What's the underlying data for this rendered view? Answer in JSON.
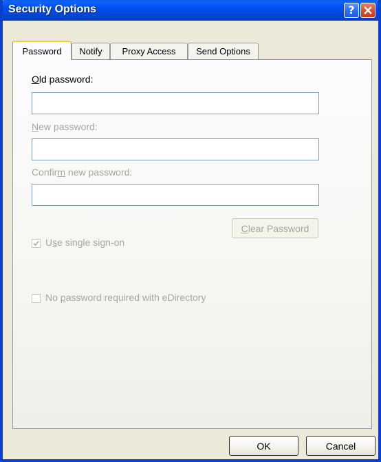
{
  "window": {
    "title": "Security Options",
    "help_glyph": "?",
    "close_glyph": "×"
  },
  "tabs": [
    {
      "label": "Password",
      "active": true
    },
    {
      "label": "Notify",
      "active": false
    },
    {
      "label": "Proxy Access",
      "active": false
    },
    {
      "label": "Send Options",
      "active": false
    }
  ],
  "password_tab": {
    "old_password": {
      "label_prefix": "",
      "label_mnemonic": "O",
      "label_suffix": "ld password:",
      "value": ""
    },
    "new_password": {
      "label_prefix": "",
      "label_mnemonic": "N",
      "label_suffix": "ew password:",
      "value": ""
    },
    "confirm_password": {
      "label_prefix": "Confir",
      "label_mnemonic": "m",
      "label_suffix": " new password:",
      "value": ""
    },
    "clear_password_button": {
      "mnemonic": "C",
      "rest": "lear Password"
    },
    "single_sign_on": {
      "prefix": "U",
      "mnemonic": "s",
      "suffix": "e single sign-on",
      "checked": true
    },
    "no_password_edirectory": {
      "prefix": "No ",
      "mnemonic": "p",
      "suffix": "assword required with eDirectory",
      "checked": false
    }
  },
  "buttons": {
    "ok": "OK",
    "cancel": "Cancel"
  },
  "colors": {
    "titlebar_blue": "#0050ee",
    "dialog_face": "#ece9d8",
    "disabled_text": "#a7a69e",
    "tab_highlight": "#ffc83c"
  }
}
